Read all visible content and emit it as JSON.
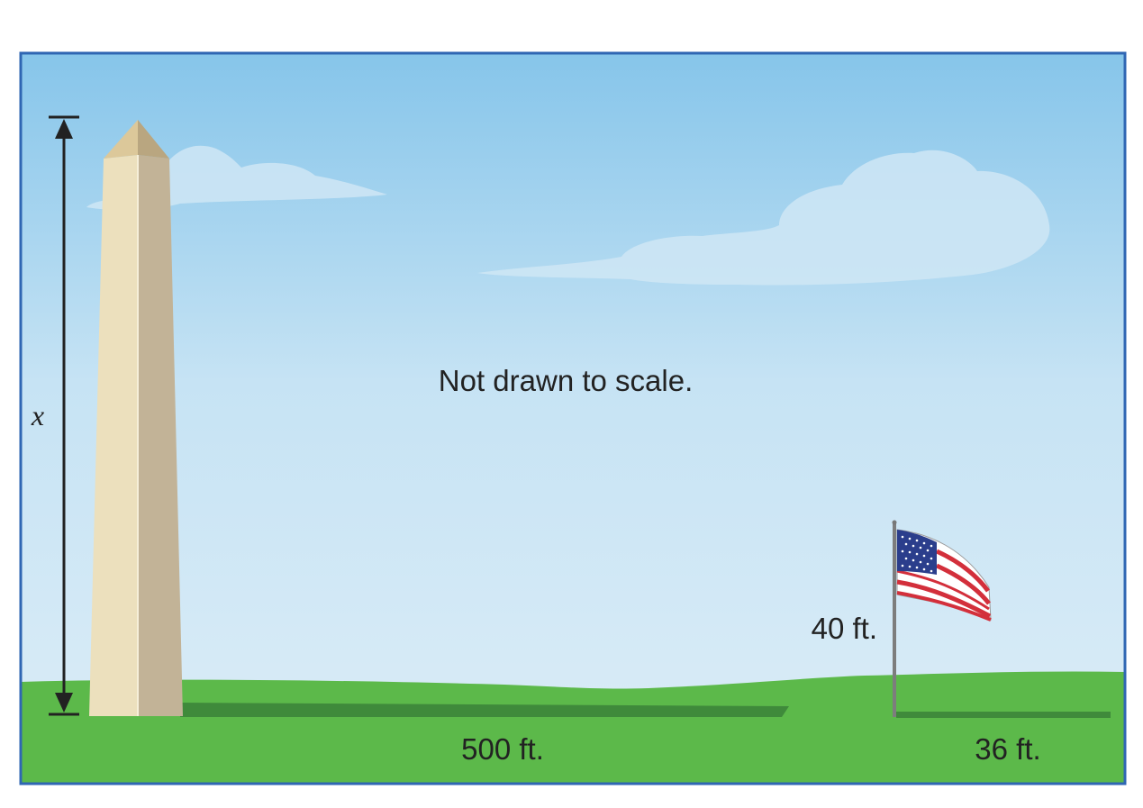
{
  "diagram": {
    "caption": "Not drawn to scale.",
    "monument_height_label": "x",
    "monument_shadow_label": "500 ft.",
    "flagpole_height_label": "40 ft.",
    "flagpole_shadow_label": "36 ft."
  },
  "colors": {
    "frame": "#2f66b3",
    "sky_top": "#86c5ea",
    "sky_bottom": "#dcedf7",
    "grass": "#5cb94a",
    "shadow": "#3f8a3b",
    "monument_light": "#ece0bd",
    "monument_dark": "#c2b397",
    "flag_blue": "#2b3e8c",
    "flag_red": "#d32f3b"
  }
}
